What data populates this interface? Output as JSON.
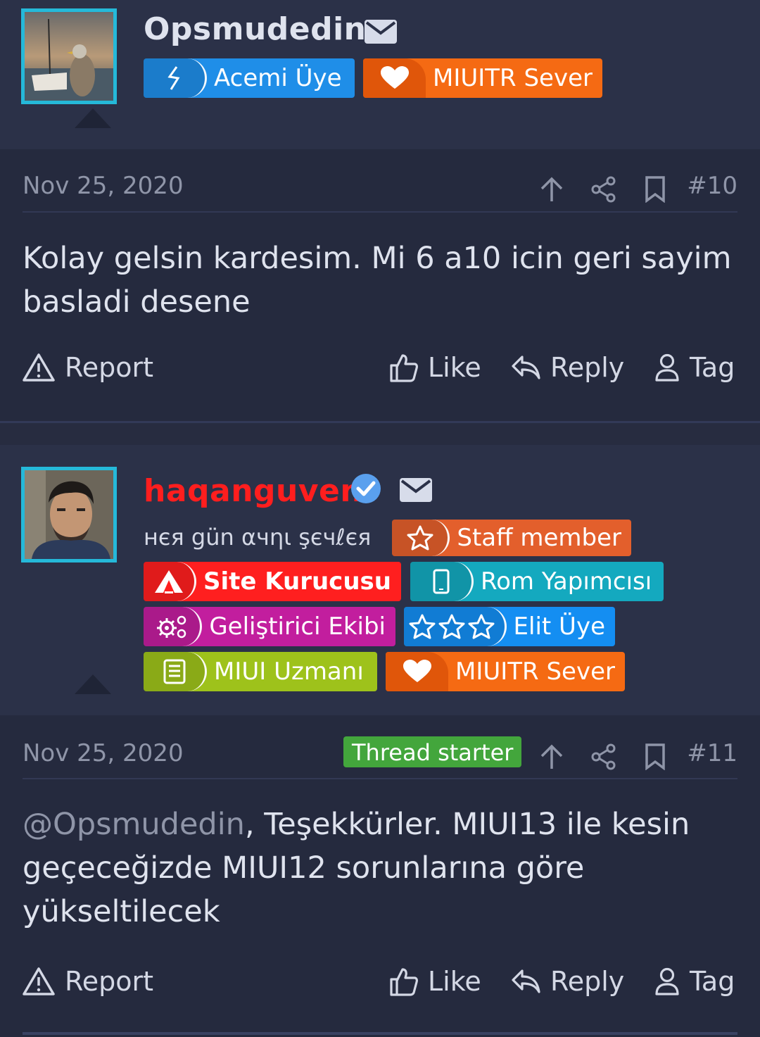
{
  "posts": [
    {
      "username": "Opsmudedin",
      "username_color": "#dfe3ee",
      "badges": [
        {
          "label": "Acemi Üye",
          "color": "#1f8ee8",
          "icon": "leaf-icon"
        },
        {
          "label": "MIUITR Sever",
          "color": "#f56a13",
          "icon": "heart-icon"
        }
      ],
      "date": "Nov 25, 2020",
      "number": "#10",
      "message": "Kolay gelsin kardesim. Mi 6 a10 icin geri sayim basladi desene",
      "actions": {
        "report": "Report",
        "like": "Like",
        "reply": "Reply",
        "tag": "Tag"
      }
    },
    {
      "username": "haqanguven",
      "username_color": "#ff1e1e",
      "user_title": "нєя gün αчηι şєчℓєя",
      "badges": [
        {
          "label": "Staff member",
          "color": "#e35f2c",
          "icon": "star-outline-icon"
        },
        {
          "label": "Site Kurucusu",
          "color": "#ff1f1f",
          "icon": "tent-icon"
        },
        {
          "label": "Rom Yapımcısı",
          "color": "#14a9bf",
          "icon": "phone-icon"
        },
        {
          "label": "Geliştirici Ekibi",
          "color": "#c21e9e",
          "icon": "gears-icon"
        },
        {
          "label": "Elit Üye",
          "color": "#148ef2",
          "icon": "three-stars-icon"
        },
        {
          "label": "MIUI Uzmanı",
          "color": "#9ec21b",
          "icon": "book-icon"
        },
        {
          "label": "MIUITR Sever",
          "color": "#f56a13",
          "icon": "heart-icon"
        }
      ],
      "date": "Nov 25, 2020",
      "thread_starter": "Thread starter",
      "number": "#11",
      "mention": "@Opsmudedin",
      "message": ", Teşekkürler. MIUI13 ile kesin geçeceğizde MIUI12 sorunlarına göre yükseltilecek",
      "actions": {
        "report": "Report",
        "like": "Like",
        "reply": "Reply",
        "tag": "Tag"
      }
    }
  ],
  "colors": {
    "bg": "#2b3148",
    "content_bg": "#252a3e",
    "avatar_border": "#25b9d9",
    "muted": "#8f95a8"
  }
}
